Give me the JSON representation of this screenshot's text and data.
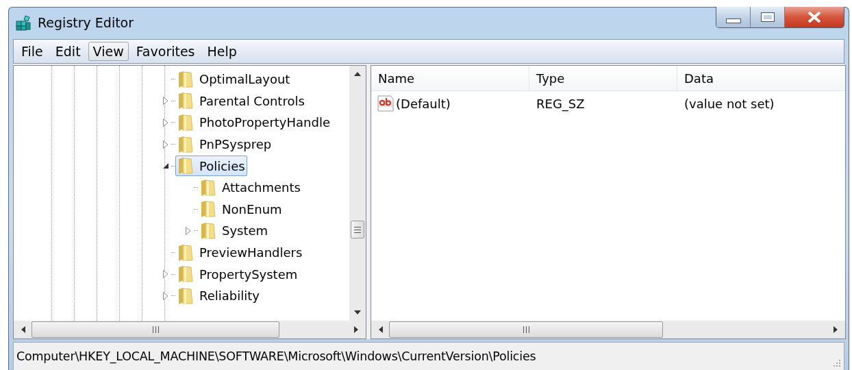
{
  "window": {
    "title": "Registry Editor"
  },
  "menu": [
    {
      "label": "File",
      "selected": false
    },
    {
      "label": "Edit",
      "selected": false
    },
    {
      "label": "View",
      "selected": true
    },
    {
      "label": "Favorites",
      "selected": false
    },
    {
      "label": "Help",
      "selected": false
    }
  ],
  "tree": {
    "items": [
      {
        "label": "OptimalLayout",
        "selected": false
      },
      {
        "label": "Parental Controls",
        "selected": false,
        "expanded": false
      },
      {
        "label": "PhotoPropertyHandle",
        "selected": false,
        "expanded": false
      },
      {
        "label": "PnPSysprep",
        "selected": false,
        "expanded": false
      },
      {
        "label": "Policies",
        "selected": true,
        "expanded": true,
        "children": [
          {
            "label": "Attachments",
            "selected": false
          },
          {
            "label": "NonEnum",
            "selected": false
          },
          {
            "label": "System",
            "selected": false,
            "expanded": false
          }
        ]
      },
      {
        "label": "PreviewHandlers",
        "selected": false
      },
      {
        "label": "PropertySystem",
        "selected": false,
        "expanded": false
      },
      {
        "label": "Reliability",
        "selected": false,
        "expanded": false
      }
    ]
  },
  "values": {
    "columns": [
      "Name",
      "Type",
      "Data"
    ],
    "rows": [
      {
        "name": "(Default)",
        "type": "REG_SZ",
        "data": "(value not set)"
      }
    ]
  },
  "status_bar": "Computer\\HKEY_LOCAL_MACHINE\\SOFTWARE\\Microsoft\\Windows\\CurrentVersion\\Policies"
}
